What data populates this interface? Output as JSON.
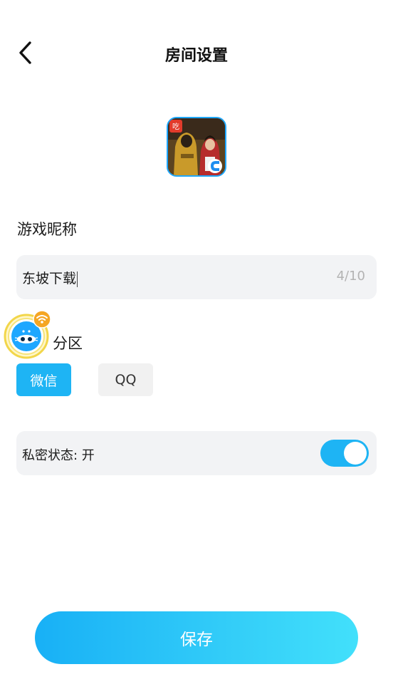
{
  "header": {
    "title": "房间设置",
    "back_icon": "chevron-left-icon"
  },
  "game": {
    "icon": "game-thumbnail"
  },
  "nickname": {
    "label": "游戏昵称",
    "value": "东坡下载",
    "counter": "4/10"
  },
  "region": {
    "label": "分区",
    "options": [
      {
        "label": "微信",
        "selected": true
      },
      {
        "label": "QQ",
        "selected": false
      }
    ]
  },
  "private": {
    "label": "私密状态: 开",
    "enabled": true
  },
  "save_label": "保存",
  "colors": {
    "accent": "#1eb4f4",
    "save_gradient_start": "#18b0f6",
    "save_gradient_end": "#42e0fb",
    "field_bg": "#f2f3f5",
    "wifi_badge": "#f5a623"
  }
}
